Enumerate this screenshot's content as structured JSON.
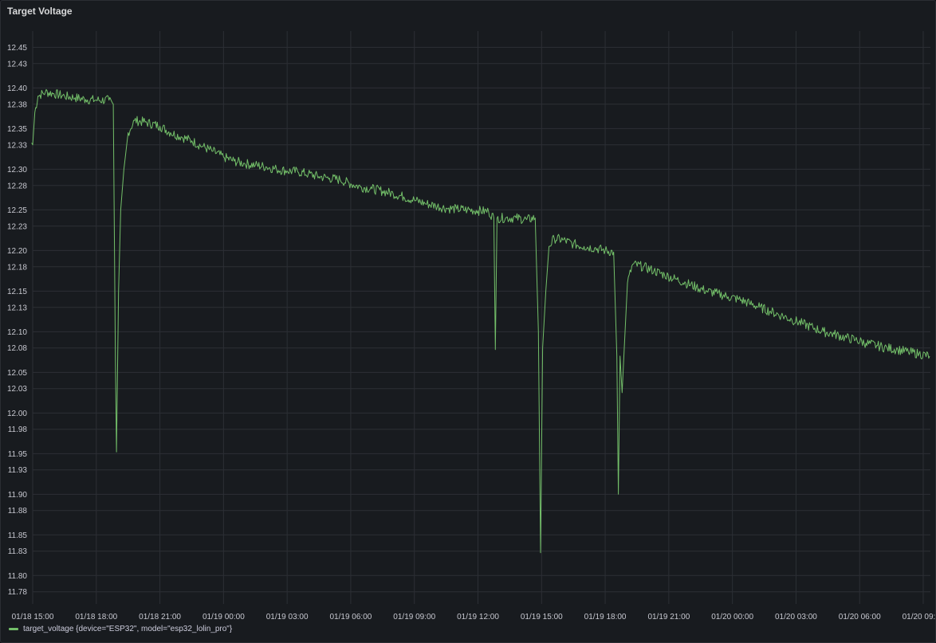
{
  "panel": {
    "title": "Target Voltage"
  },
  "chart_data": {
    "type": "line",
    "xlabel": "",
    "ylabel": "",
    "ylim": [
      11.765,
      12.47
    ],
    "y_ticks": [
      "11.78",
      "11.80",
      "11.83",
      "11.85",
      "11.88",
      "11.90",
      "11.93",
      "11.95",
      "11.98",
      "12.00",
      "12.03",
      "12.05",
      "12.08",
      "12.10",
      "12.13",
      "12.15",
      "12.18",
      "12.20",
      "12.23",
      "12.25",
      "12.28",
      "12.30",
      "12.33",
      "12.35",
      "12.38",
      "12.40",
      "12.43",
      "12.45"
    ],
    "x_ticks": [
      "01/18 15:00",
      "01/18 18:00",
      "01/18 21:00",
      "01/19 00:00",
      "01/19 03:00",
      "01/19 06:00",
      "01/19 09:00",
      "01/19 12:00",
      "01/19 15:00",
      "01/19 18:00",
      "01/19 21:00",
      "01/20 00:00",
      "01/20 03:00",
      "01/20 06:00",
      "01/20 09:00"
    ],
    "x_unit": "hours since 01/18 15:00",
    "grid": true,
    "legend_position": "bottom-left",
    "series": [
      {
        "name": "target_voltage {device=\"ESP32\", model=\"esp32_lolin_pro\"}",
        "color": "#73bf69",
        "points": [
          [
            -0.1,
            12.335
          ],
          [
            0.0,
            12.33
          ],
          [
            0.1,
            12.37
          ],
          [
            0.25,
            12.39
          ],
          [
            0.6,
            12.395
          ],
          [
            1.0,
            12.393
          ],
          [
            1.5,
            12.39
          ],
          [
            2.0,
            12.388
          ],
          [
            2.5,
            12.386
          ],
          [
            3.0,
            12.385
          ],
          [
            3.6,
            12.385
          ],
          [
            3.8,
            12.38
          ],
          [
            3.9,
            12.07
          ],
          [
            3.95,
            11.952
          ],
          [
            4.05,
            12.15
          ],
          [
            4.15,
            12.25
          ],
          [
            4.3,
            12.3
          ],
          [
            4.5,
            12.345
          ],
          [
            4.8,
            12.36
          ],
          [
            5.3,
            12.358
          ],
          [
            6.0,
            12.353
          ],
          [
            6.5,
            12.345
          ],
          [
            7.0,
            12.34
          ],
          [
            7.5,
            12.335
          ],
          [
            8.0,
            12.328
          ],
          [
            8.5,
            12.322
          ],
          [
            9.0,
            12.315
          ],
          [
            9.5,
            12.31
          ],
          [
            10.0,
            12.307
          ],
          [
            10.5,
            12.305
          ],
          [
            11.0,
            12.303
          ],
          [
            11.5,
            12.3
          ],
          [
            12.0,
            12.298
          ],
          [
            12.5,
            12.297
          ],
          [
            13.0,
            12.294
          ],
          [
            13.5,
            12.291
          ],
          [
            14.0,
            12.289
          ],
          [
            14.5,
            12.287
          ],
          [
            15.0,
            12.282
          ],
          [
            15.5,
            12.278
          ],
          [
            16.0,
            12.276
          ],
          [
            16.5,
            12.273
          ],
          [
            17.0,
            12.27
          ],
          [
            17.5,
            12.266
          ],
          [
            18.0,
            12.262
          ],
          [
            18.5,
            12.258
          ],
          [
            19.0,
            12.255
          ],
          [
            19.5,
            12.252
          ],
          [
            20.0,
            12.251
          ],
          [
            20.5,
            12.25
          ],
          [
            21.0,
            12.249
          ],
          [
            21.5,
            12.248
          ],
          [
            21.75,
            12.24
          ],
          [
            21.82,
            12.078
          ],
          [
            21.9,
            12.24
          ],
          [
            22.3,
            12.24
          ],
          [
            22.8,
            12.24
          ],
          [
            23.3,
            12.238
          ],
          [
            23.7,
            12.24
          ],
          [
            23.85,
            12.1
          ],
          [
            23.95,
            11.828
          ],
          [
            24.05,
            12.08
          ],
          [
            24.2,
            12.15
          ],
          [
            24.35,
            12.205
          ],
          [
            24.6,
            12.215
          ],
          [
            25.0,
            12.213
          ],
          [
            25.5,
            12.208
          ],
          [
            26.0,
            12.205
          ],
          [
            26.5,
            12.203
          ],
          [
            27.0,
            12.2
          ],
          [
            27.4,
            12.198
          ],
          [
            27.55,
            12.07
          ],
          [
            27.62,
            11.9
          ],
          [
            27.7,
            12.07
          ],
          [
            27.8,
            12.025
          ],
          [
            27.9,
            12.08
          ],
          [
            28.05,
            12.16
          ],
          [
            28.3,
            12.183
          ],
          [
            28.8,
            12.18
          ],
          [
            29.3,
            12.175
          ],
          [
            29.8,
            12.17
          ],
          [
            30.3,
            12.165
          ],
          [
            30.8,
            12.16
          ],
          [
            31.3,
            12.155
          ],
          [
            31.8,
            12.15
          ],
          [
            32.3,
            12.147
          ],
          [
            32.8,
            12.143
          ],
          [
            33.3,
            12.14
          ],
          [
            33.8,
            12.135
          ],
          [
            34.3,
            12.13
          ],
          [
            34.8,
            12.125
          ],
          [
            35.3,
            12.12
          ],
          [
            35.8,
            12.115
          ],
          [
            36.3,
            12.11
          ],
          [
            36.8,
            12.105
          ],
          [
            37.3,
            12.1
          ],
          [
            37.8,
            12.097
          ],
          [
            38.3,
            12.093
          ],
          [
            38.8,
            12.09
          ],
          [
            39.3,
            12.086
          ],
          [
            39.8,
            12.083
          ],
          [
            40.3,
            12.08
          ],
          [
            40.8,
            12.078
          ],
          [
            41.3,
            12.075
          ],
          [
            41.8,
            12.073
          ],
          [
            42.3,
            12.07
          ]
        ]
      }
    ]
  }
}
